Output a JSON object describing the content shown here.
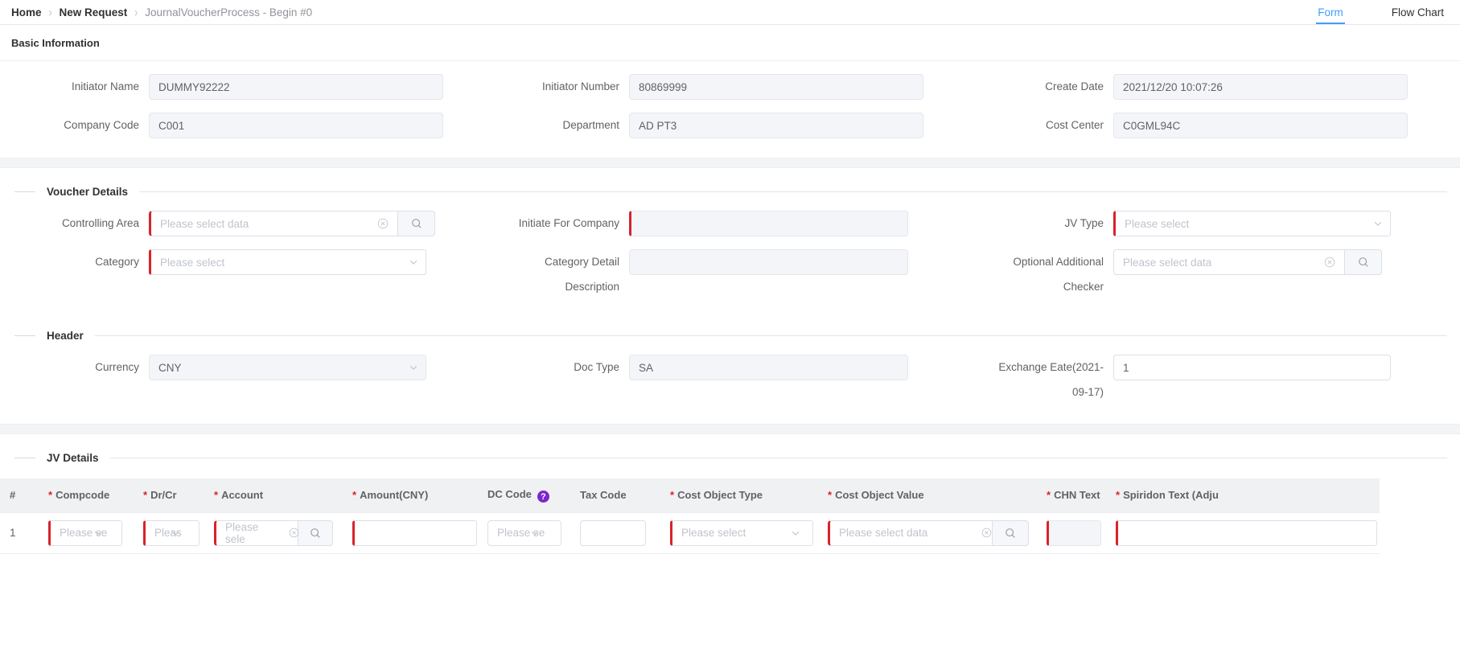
{
  "breadcrumb": {
    "items": [
      {
        "label": "Home",
        "current": false
      },
      {
        "label": "New Request",
        "current": false
      },
      {
        "label": "JournalVoucherProcess - Begin #0",
        "current": true
      }
    ],
    "separator": "›"
  },
  "tabs": [
    {
      "label": "Form",
      "active": true
    },
    {
      "label": "Flow Chart",
      "active": false
    }
  ],
  "colors": {
    "accent": "#409eff",
    "required": "#d8232a",
    "help_badge": "#7d26cd",
    "header_bg": "#f0f1f3",
    "disabled_bg": "#f4f5f8"
  },
  "basic_information": {
    "title": "Basic Information",
    "fields": [
      {
        "label": "Initiator Name",
        "value": "DUMMY92222"
      },
      {
        "label": "Initiator Number",
        "value": "80869999"
      },
      {
        "label": "Create Date",
        "value": "2021/12/20 10:07:26"
      },
      {
        "label": "Company Code",
        "value": "C001"
      },
      {
        "label": "Department",
        "value": "AD PT3"
      },
      {
        "label": "Cost Center",
        "value": "C0GML94C"
      }
    ]
  },
  "voucher_details": {
    "title": "Voucher Details",
    "controlling_area": {
      "label": "Controlling Area",
      "placeholder": "Please select data",
      "value": ""
    },
    "initiate_for_company": {
      "label": "Initiate For Company",
      "value": ""
    },
    "jv_type": {
      "label": "JV Type",
      "placeholder": "Please select",
      "value": ""
    },
    "category": {
      "label": "Category",
      "placeholder": "Please select",
      "value": ""
    },
    "category_detail_description": {
      "label_line1": "Category Detail",
      "label_line2": "Description",
      "value": ""
    },
    "optional_additional_checker": {
      "label_line1": "Optional Additional",
      "label_line2": "Checker",
      "placeholder": "Please select data",
      "value": ""
    }
  },
  "header_section": {
    "title": "Header",
    "currency": {
      "label": "Currency",
      "value": "CNY"
    },
    "doc_type": {
      "label": "Doc Type",
      "value": "SA"
    },
    "exchange_rate": {
      "label_line1": "Exchange Eate(2021-",
      "label_line2": "09-17)",
      "value": "1"
    }
  },
  "jv_details": {
    "title": "JV Details",
    "columns": [
      {
        "label": "#",
        "required": false,
        "help": false
      },
      {
        "label": "Compcode",
        "required": true,
        "help": false
      },
      {
        "label": "Dr/Cr",
        "required": true,
        "help": false
      },
      {
        "label": "Account",
        "required": true,
        "help": false
      },
      {
        "label": "Amount(CNY)",
        "required": true,
        "help": false
      },
      {
        "label": "DC Code",
        "required": false,
        "help": true
      },
      {
        "label": "Tax Code",
        "required": false,
        "help": false
      },
      {
        "label": "Cost Object Type",
        "required": true,
        "help": false
      },
      {
        "label": "Cost Object Value",
        "required": true,
        "help": false
      },
      {
        "label": "CHN Text",
        "required": true,
        "help": false
      },
      {
        "label": "Spiridon Text  (Adju",
        "required": true,
        "help": false
      }
    ],
    "help_badge_text": "?",
    "rows": [
      {
        "index": "1",
        "compcode": {
          "placeholder": "Please se",
          "value": ""
        },
        "drcr": {
          "placeholder": "Pleas",
          "value": ""
        },
        "account": {
          "placeholder": "Please sele",
          "value": ""
        },
        "amount": {
          "placeholder": "",
          "value": ""
        },
        "dc_code": {
          "placeholder": "Please se",
          "value": ""
        },
        "tax_code": {
          "placeholder": "",
          "value": ""
        },
        "cost_object_type": {
          "placeholder": "Please select",
          "value": ""
        },
        "cost_object_value": {
          "placeholder": "Please select data",
          "value": ""
        },
        "chn_text": {
          "placeholder": "",
          "value": ""
        },
        "spiridon_text": {
          "placeholder": "",
          "value": ""
        }
      }
    ]
  }
}
